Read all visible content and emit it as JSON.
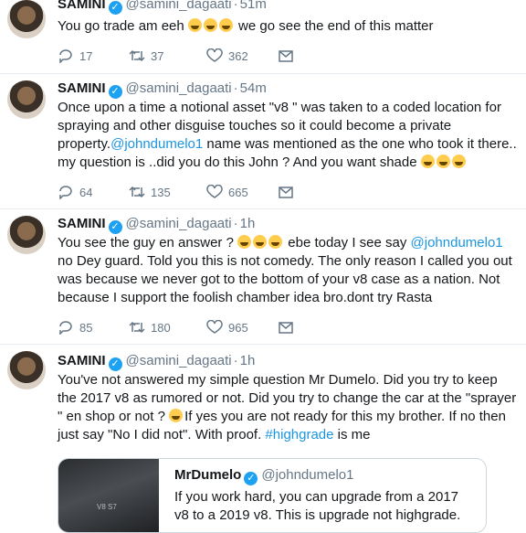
{
  "tweets": [
    {
      "name": "SAMINI",
      "handle": "@samini_dagaati",
      "time": "51m",
      "text_parts": [
        "You go trade am eeh ",
        " we go see the end of this matter"
      ],
      "replies": "17",
      "retweets": "37",
      "likes": "362"
    },
    {
      "name": "SAMINI",
      "handle": "@samini_dagaati",
      "time": "54m",
      "text_a": "Once upon a time a notional asset \"v8 \" was taken to a coded location for spraying and other disguise touches so it could become a private property.",
      "mention": "@johndumelo1",
      "text_b": " name was mentioned as the one who took it there.. my question is ..did you do this John ? And you want shade ",
      "replies": "64",
      "retweets": "135",
      "likes": "665"
    },
    {
      "name": "SAMINI",
      "handle": "@samini_dagaati",
      "time": "1h",
      "text_a": "You see the guy en answer ? ",
      "text_b": " ebe today I see say ",
      "mention": "@johndumelo1",
      "text_c": " no Dey guard. Told you this is not comedy. The only reason I called you out was because we never got to the bottom of your v8 case as a nation. Not because I support the foolish chamber idea bro.dont try Rasta",
      "replies": "85",
      "retweets": "180",
      "likes": "965"
    },
    {
      "name": "SAMINI",
      "handle": "@samini_dagaati",
      "time": "1h",
      "text_a": "You've not answered my simple question Mr Dumelo. Did you try to keep the 2017 v8 as rumored or not. Did you try to change the car at the \"sprayer \" en shop or not ? ",
      "text_b": "If yes you are not ready for this my brother. If no then just say \"No I did not\". With proof. ",
      "hashtag": "#highgrade",
      "text_c": " is me"
    }
  ],
  "quoted": {
    "name": "MrDumelo",
    "handle": "@johndumelo1",
    "text": "If you work hard, you can upgrade from a 2017 v8 to a 2019 v8. This is upgrade not highgrade.",
    "plate": "V8 S7"
  },
  "icons": [
    "reply-icon",
    "retweet-icon",
    "like-icon",
    "message-icon",
    "verified-icon"
  ],
  "colors": {
    "link": "#1b95e0",
    "verified": "#1da1f2",
    "muted": "#657786"
  }
}
